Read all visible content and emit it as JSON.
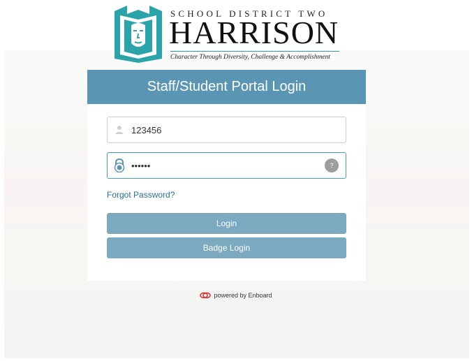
{
  "logo": {
    "subtitle": "SCHOOL DISTRICT TWO",
    "name": "HARRISON",
    "tagline": "Character Through Diversity, Challenge & Accomplishment"
  },
  "login": {
    "title": "Staff/Student Portal Login",
    "username_value": "123456",
    "password_value": "••••••",
    "help_label": "?",
    "forgot_label": "Forgot Password?",
    "login_label": "Login",
    "badge_login_label": "Badge Login"
  },
  "footer": {
    "powered_label": "powered by Enboard"
  },
  "colors": {
    "header": "#5a96b3",
    "button": "#7aa9c0",
    "brand_teal": "#2aa3a9",
    "link": "#2b6d9c"
  },
  "icons": {
    "user": "user-icon",
    "lock": "lock-icon",
    "help": "help-icon",
    "enboard": "enboard-logo-icon"
  }
}
